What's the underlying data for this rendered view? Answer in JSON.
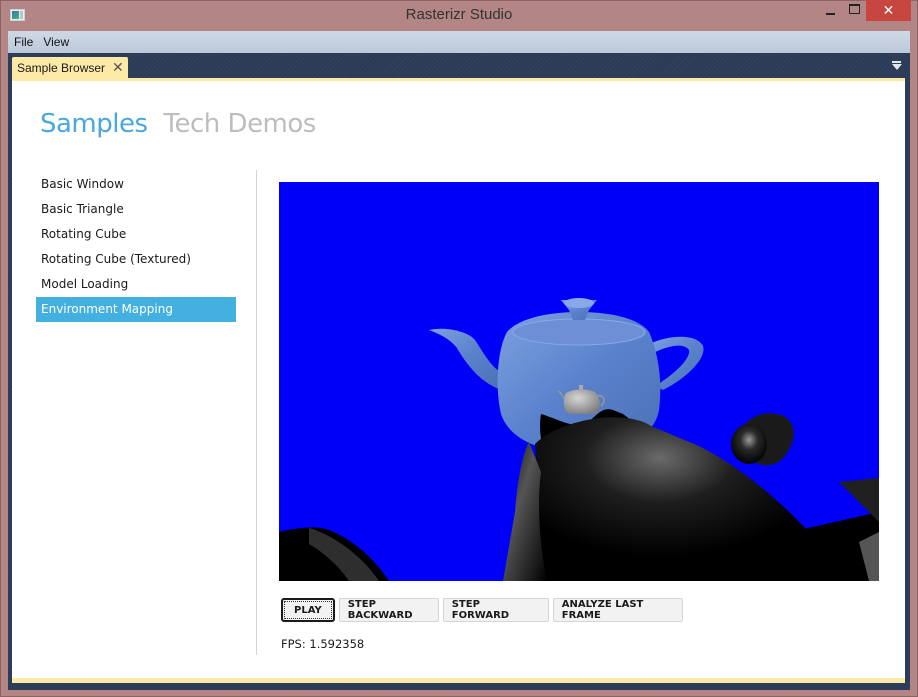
{
  "window": {
    "title": "Rasterizr Studio",
    "icons": {
      "app": "app-icon",
      "minimize": "minimize-icon",
      "maximize": "maximize-icon",
      "close": "close-icon"
    },
    "close_glyph": "✕"
  },
  "menubar": {
    "items": [
      {
        "label": "File"
      },
      {
        "label": "View"
      }
    ]
  },
  "document_tabs": [
    {
      "label": "Sample Browser",
      "close_glyph": "✕",
      "active": true
    }
  ],
  "header": {
    "tabs": [
      {
        "label": "Samples",
        "active": true
      },
      {
        "label": "Tech Demos",
        "active": false
      }
    ]
  },
  "samples": {
    "items": [
      {
        "label": "Basic Window",
        "selected": false
      },
      {
        "label": "Basic Triangle",
        "selected": false
      },
      {
        "label": "Rotating Cube",
        "selected": false
      },
      {
        "label": "Rotating Cube (Textured)",
        "selected": false
      },
      {
        "label": "Model Loading",
        "selected": false
      },
      {
        "label": "Environment Mapping",
        "selected": true
      }
    ]
  },
  "viewport": {
    "description": "Rendered scene: environment-mapped teapots on blue background",
    "background_color": "#0000fa"
  },
  "controls": {
    "play": "PLAY",
    "step_backward": "STEP BACKWARD",
    "step_forward": "STEP FORWARD",
    "analyze_last_frame": "ANALYZE LAST FRAME"
  },
  "status": {
    "fps_label": "FPS: 1.592358"
  },
  "colors": {
    "accent": "#43b0e0",
    "header_active": "#4aa9dc",
    "header_inactive": "#bdbdbd",
    "window_frame": "#b38584",
    "client_bg": "#2b3b57",
    "tab_bg": "#fde9a6",
    "close_button": "#c7463f"
  }
}
